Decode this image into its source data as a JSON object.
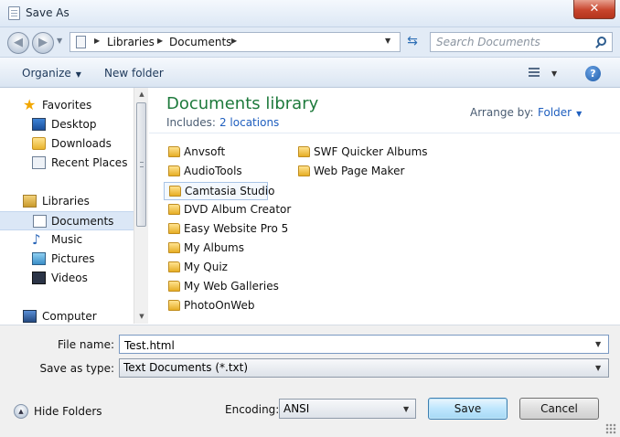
{
  "window": {
    "title": "Save As",
    "close_glyph": "✕"
  },
  "address": {
    "back_glyph": "◀",
    "forward_glyph": "▶",
    "breadcrumbs": [
      "Libraries",
      "Documents"
    ],
    "search_placeholder": "Search Documents",
    "refresh_glyph": "⇆"
  },
  "commandbar": {
    "organize_label": "Organize",
    "newfolder_label": "New folder",
    "help_glyph": "?"
  },
  "nav": {
    "items": [
      {
        "label": "Favorites",
        "icon": "star-icon"
      },
      {
        "label": "Desktop",
        "icon": "desktop-icon"
      },
      {
        "label": "Downloads",
        "icon": "downloads-folder-icon"
      },
      {
        "label": "Recent Places",
        "icon": "recent-places-icon"
      },
      {
        "label": "Libraries",
        "icon": "libraries-icon"
      },
      {
        "label": "Documents",
        "icon": "documents-icon"
      },
      {
        "label": "Music",
        "icon": "music-icon"
      },
      {
        "label": "Pictures",
        "icon": "pictures-icon"
      },
      {
        "label": "Videos",
        "icon": "videos-icon"
      },
      {
        "label": "Computer",
        "icon": "computer-icon"
      }
    ],
    "selected": "Documents"
  },
  "library": {
    "title": "Documents library",
    "includes_label": "Includes:",
    "locations_link": "2 locations",
    "arrange_label": "Arrange by:",
    "arrange_value": "Folder"
  },
  "files": {
    "column1": [
      "Anvsoft",
      "AudioTools",
      "Camtasia Studio",
      "DVD Album Creator",
      "Easy Website Pro 5",
      "My Albums",
      "My Quiz",
      "My Web Galleries",
      "PhotoOnWeb"
    ],
    "column2": [
      "SWF Quicker Albums",
      "Web Page Maker"
    ],
    "focused": "Camtasia Studio"
  },
  "form": {
    "filename_label": "File name:",
    "filename_value": "Test.html",
    "savetype_label": "Save as type:",
    "savetype_value": "Text Documents (*.txt)",
    "hide_folders_label": "Hide Folders",
    "encoding_label": "Encoding:",
    "encoding_value": "ANSI",
    "save_label": "Save",
    "cancel_label": "Cancel"
  },
  "colors": {
    "library_title": "#1e7a3c",
    "link": "#1f5fbf",
    "close_button": "#c8452d"
  }
}
